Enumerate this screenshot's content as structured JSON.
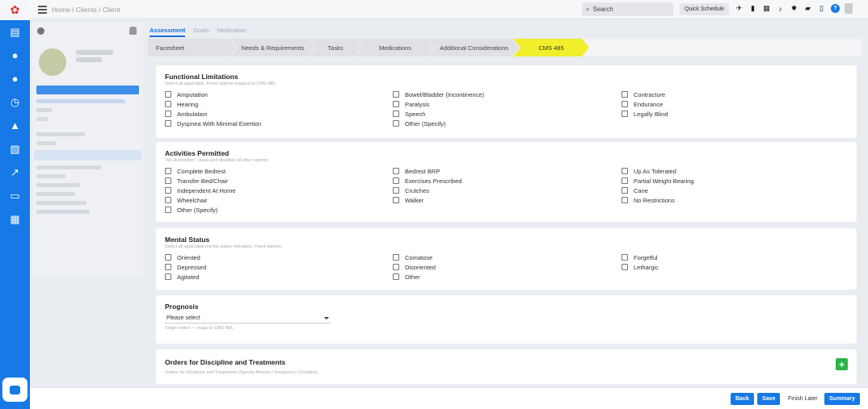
{
  "topbar": {
    "breadcrumb": "Home / Clients / Client",
    "search_label": "Search",
    "quick_schedule": "Quick Schedule"
  },
  "tabs": [
    {
      "label": "Assessment",
      "active": true
    },
    {
      "label": "Goals",
      "active": false
    },
    {
      "label": "Medication",
      "active": false
    }
  ],
  "steps": [
    {
      "label": "Facesheet"
    },
    {
      "label": "Needs & Requirements"
    },
    {
      "label": "Tasks"
    },
    {
      "label": "Medications"
    },
    {
      "label": "Additional Considerations"
    },
    {
      "label": "CMS 485",
      "active": true
    }
  ],
  "functional": {
    "title": "Functional Limitations",
    "hint": "Select all applicable. Fixed options mapped to CMS 485.",
    "col1": [
      "Amputation",
      "Hearing",
      "Ambulation",
      "Dyspnea With Minimal Exertion"
    ],
    "col2": [
      "Bowel/Bladder (Incontinence)",
      "Paralysis",
      "Speech",
      "Other (Specify)"
    ],
    "col3": [
      "Contracture",
      "Endurance",
      "Legally Blind"
    ]
  },
  "activities": {
    "title": "Activities Permitted",
    "hint": "\"No Restriction\" clears and disables all other options.",
    "col1": [
      "Complete Bedrest",
      "Transfer Bed/Chair",
      "Independent At Home",
      "Wheelchair",
      "Other (Specify)"
    ],
    "col2": [
      "Bedrest BRP",
      "Exercises Prescribed",
      "Crutches",
      "Walker"
    ],
    "col3": [
      "Up As Tolerated",
      "Partial Weight Bearing",
      "Cane",
      "No Restrictions"
    ]
  },
  "mental": {
    "title": "Mental Status",
    "hint": "Select all applicable mental status indicators. Fixed options.",
    "col1": [
      "Oriented",
      "Depressed",
      "Agitated"
    ],
    "col2": [
      "Comatose",
      "Disoriented",
      "Other"
    ],
    "col3": [
      "Forgetful",
      "Lethargic"
    ]
  },
  "prognosis": {
    "title": "Prognosis",
    "selected": "Please select",
    "hint": "Single select — maps to CMS 485."
  },
  "orders": {
    "title": "Orders for Discipline and Treatments",
    "hint": "Orders for Discipline and Treatments (Specify Amount / Frequency / Duration)",
    "add": "+"
  },
  "footer": {
    "back": "Back",
    "save": "Save",
    "finish_later": "Finish Later",
    "summary": "Summary"
  },
  "colors": {
    "accent": "#1679e6",
    "active_step": "#f1ef2c",
    "add_button": "#2db34a"
  }
}
